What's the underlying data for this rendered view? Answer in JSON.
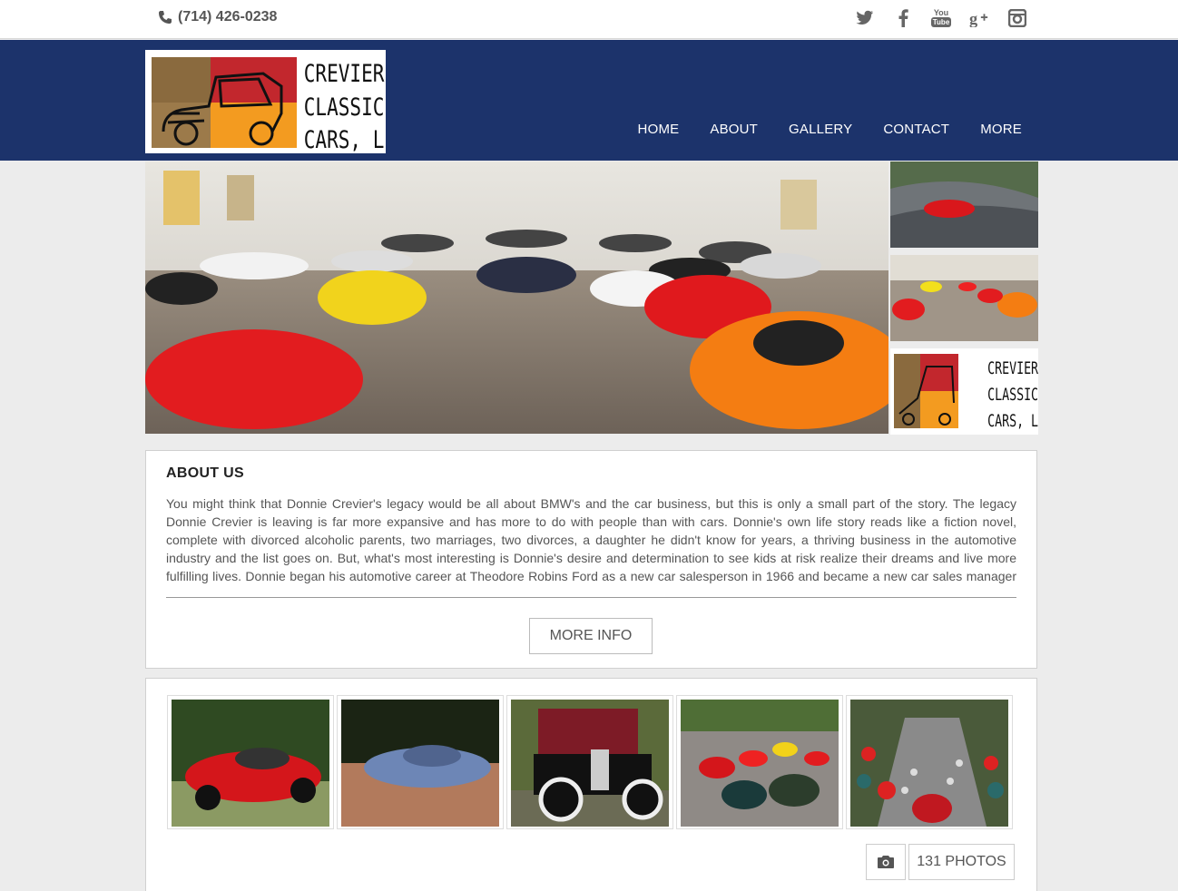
{
  "topbar": {
    "phone": "(714) 426-0238",
    "social": [
      {
        "icon": "twitter-icon"
      },
      {
        "icon": "facebook-icon"
      },
      {
        "icon": "youtube-icon",
        "text_top": "You",
        "text_bottom": "Tube"
      },
      {
        "icon": "google-plus-icon"
      },
      {
        "icon": "instagram-icon"
      }
    ]
  },
  "header": {
    "logo_lines": [
      "CREVIER",
      "CLASSIC",
      "CARS, LLC"
    ],
    "nav": [
      "HOME",
      "ABOUT",
      "GALLERY",
      "CONTACT",
      "MORE"
    ]
  },
  "about": {
    "title": "ABOUT US",
    "body": "You might think that Donnie Crevier's legacy would be all about BMW's and the car business, but this is only a small part of the story. The legacy Donnie Crevier is leaving is far more expansive and has more to do with people than with cars. Donnie's own life story reads like a fiction novel, complete with divorced alcoholic parents, two marriages, two divorces, a daughter he didn't know for years, a thriving business in the automotive industry and the list goes on. But, what's most interesting is Donnie's desire and determination to see kids at risk realize their dreams and live more fulfilling lives. Donnie began his automotive career at Theodore Robins Ford as a new car salesperson in 1966 and became a new car sales manager in",
    "button": "MORE INFO"
  },
  "gallery": {
    "photos_label": "131 PHOTOS"
  },
  "colors": {
    "header_bg": "#1c336b",
    "page_bg": "#ececec"
  }
}
